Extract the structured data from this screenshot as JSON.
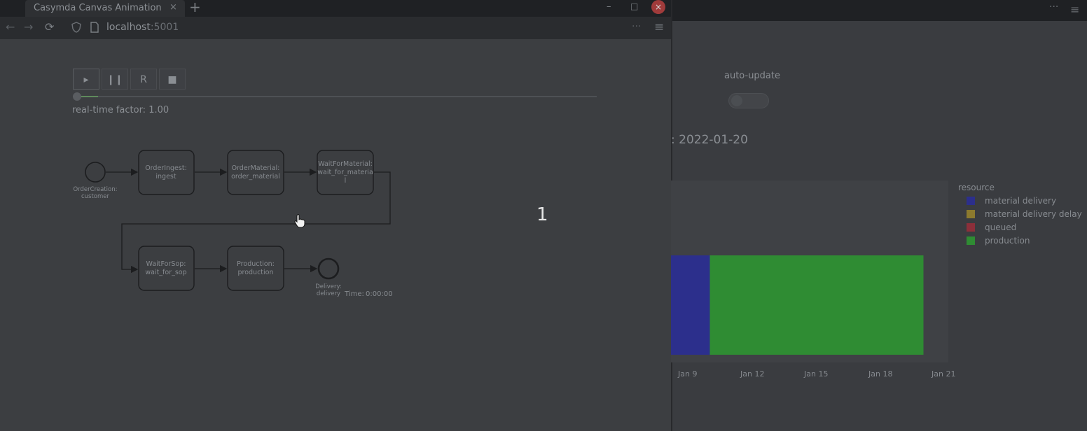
{
  "browser": {
    "tab_title": "Casymda Canvas Animation",
    "tab_close": "×",
    "new_tab": "+",
    "url_host": "localhost",
    "url_rest": ":5001",
    "window_min": "–",
    "window_max": "□",
    "window_close": "×",
    "nav_back": "←",
    "nav_forward": "→",
    "reload": "⟳",
    "menu_dots": "···",
    "menu": "≡"
  },
  "controls": {
    "play_label": "▸",
    "pause_label": "❙❙",
    "reset_label": "R",
    "stop_label": "■",
    "real_time_factor": "real-time factor: 1.00",
    "progress": 0.0
  },
  "process": {
    "start_event": {
      "line1": "OrderCreation:",
      "line2": "customer"
    },
    "tasks": [
      {
        "line1": "OrderIngest:",
        "line2": "ingest",
        "line3": ""
      },
      {
        "line1": "OrderMaterial:",
        "line2": "order_material",
        "line3": ""
      },
      {
        "line1": "WaitForMaterial:",
        "line2": "wait_for_materia",
        "line3": "l"
      },
      {
        "line1": "WaitForSop:",
        "line2": "wait_for_sop",
        "line3": ""
      },
      {
        "line1": "Production:",
        "line2": "production",
        "line3": ""
      }
    ],
    "end_event": {
      "line1": "Delivery:",
      "line2": "delivery"
    },
    "time_label": "Time:",
    "time_value": "0:00:00"
  },
  "overlay": {
    "frame_counter": "1"
  },
  "dashboard": {
    "auto_update_label": "auto-update",
    "auto_update_on": false,
    "title_fragment": ": 2022-01-20",
    "menu_dots": "···",
    "menu": "≡"
  },
  "chart_data": {
    "type": "bar",
    "orientation": "horizontal",
    "stacked": true,
    "x_ticks": [
      "Jan 9",
      "Jan 12",
      "Jan 15",
      "Jan 18",
      "Jan 21"
    ],
    "legend_title": "resource",
    "legend_placement": "top-right",
    "series": [
      {
        "name": "material delivery",
        "color": "#2c2f8c",
        "start": "2022-01-08",
        "end": "2022-01-10"
      },
      {
        "name": "material delivery delay",
        "color": "#8c7a2e",
        "start": null,
        "end": null
      },
      {
        "name": "queued",
        "color": "#8c2f3a",
        "start": null,
        "end": null
      },
      {
        "name": "production",
        "color": "#2f8c33",
        "start": "2022-01-10",
        "end": "2022-01-20"
      }
    ]
  }
}
